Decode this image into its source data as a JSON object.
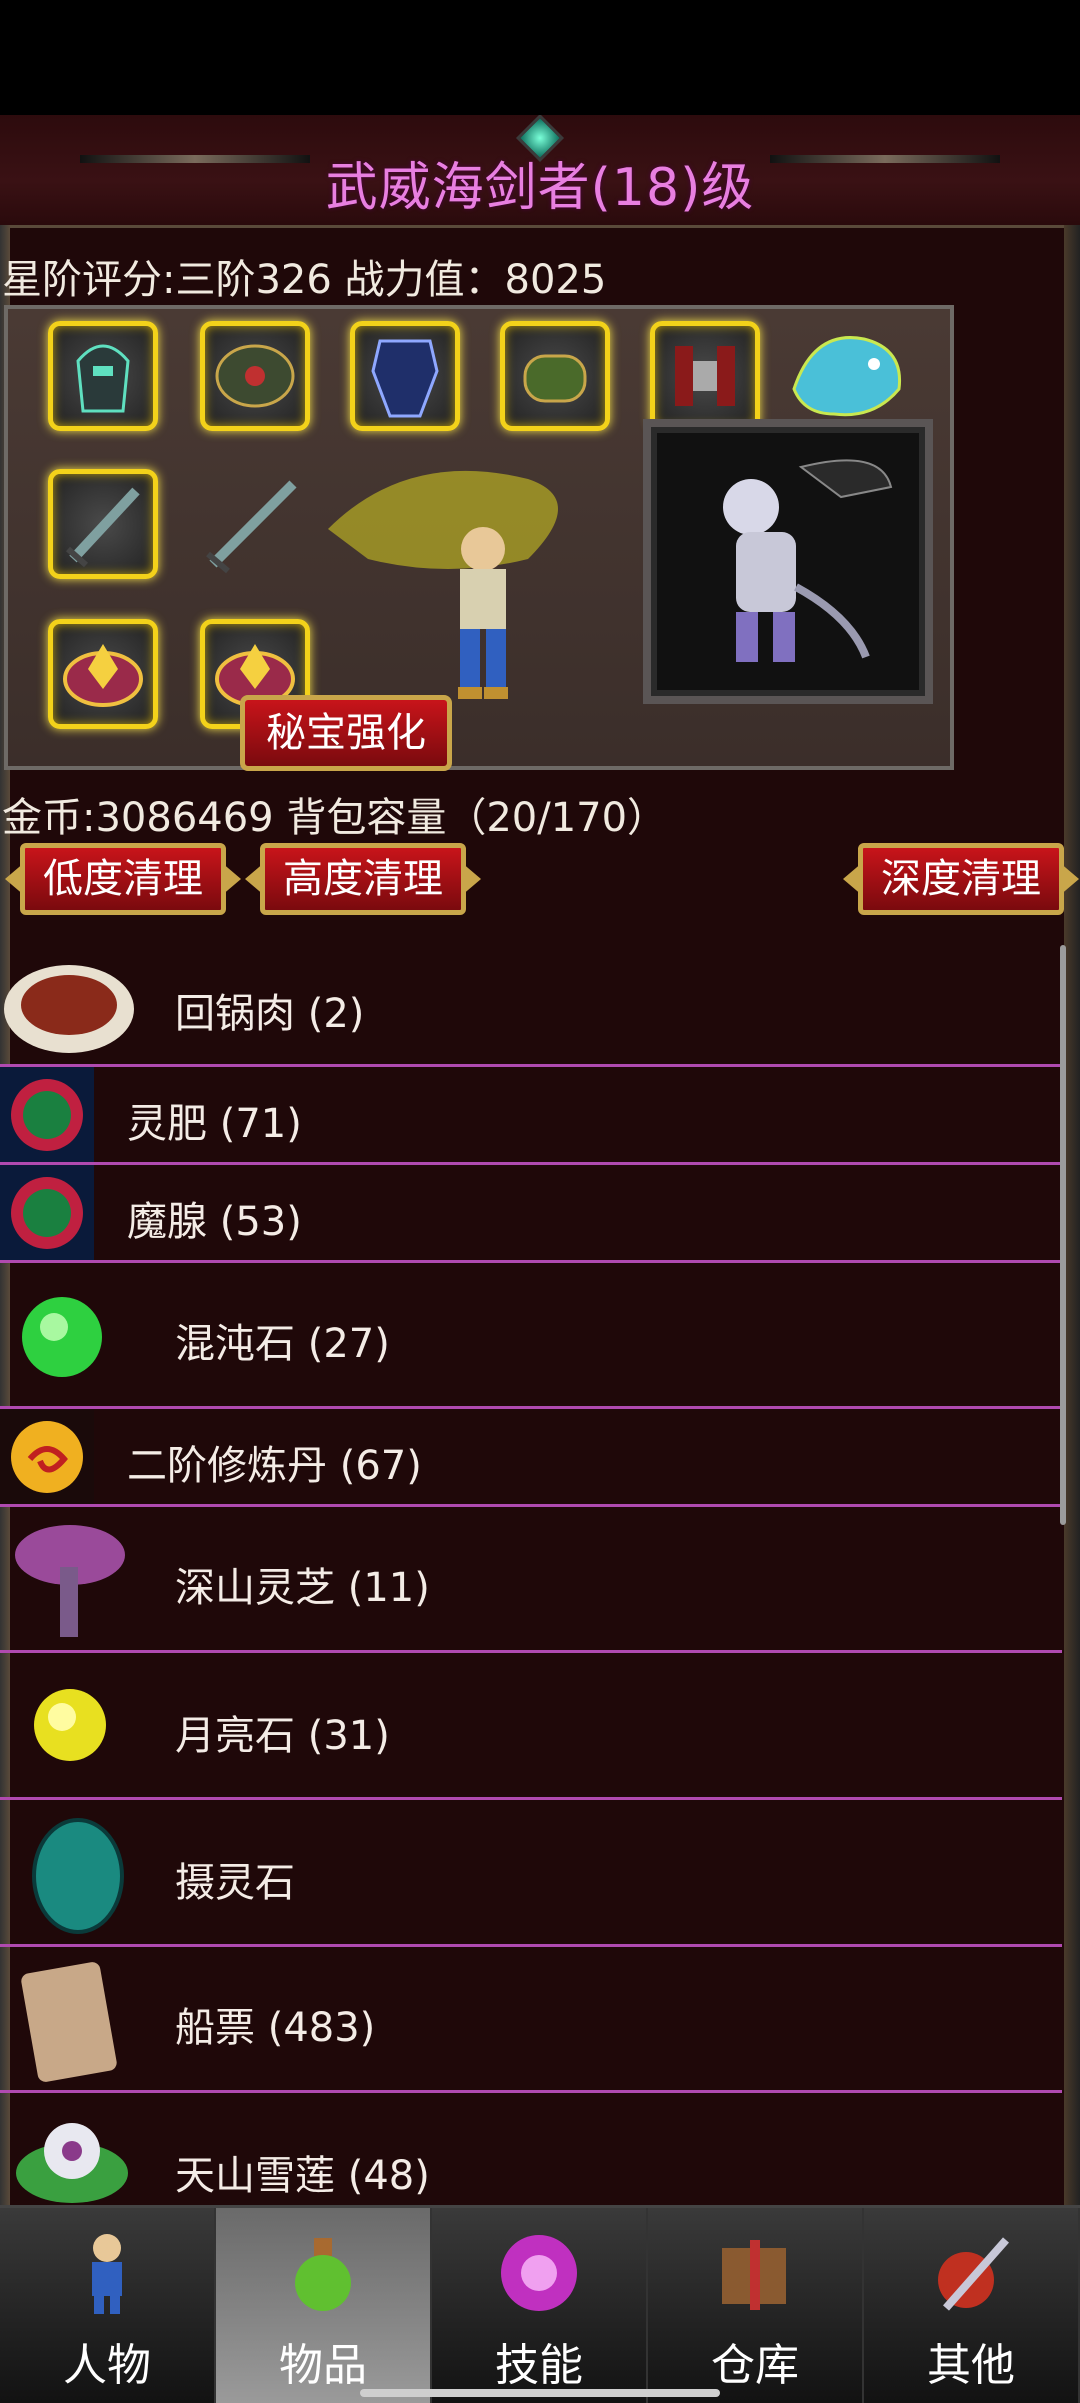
{
  "title": "武威海剑者(18)级",
  "rating": "星阶评分:三阶326 战力值：8025",
  "equipment": {
    "slots": [
      {
        "name": "helmet-icon"
      },
      {
        "name": "shoulder-armor-icon"
      },
      {
        "name": "chest-armor-icon"
      },
      {
        "name": "bracer-icon"
      },
      {
        "name": "belt-icon"
      },
      {
        "name": "mount-beast-icon"
      },
      {
        "name": "weapon-sword-icon"
      },
      {
        "name": "offhand-sword-icon"
      },
      {
        "name": "ring-left-icon"
      },
      {
        "name": "ring-right-icon"
      }
    ],
    "secret_button": "秘宝强化"
  },
  "gold": "金币:3086469 背包容量（20/170）",
  "clean_buttons": {
    "low": "低度清理",
    "high": "高度清理",
    "deep": "深度清理"
  },
  "items": [
    {
      "label": "回锅肉 (2)",
      "icon": "food-plate-icon"
    },
    {
      "label": "灵肥 (71)",
      "icon": "spirit-orb-icon"
    },
    {
      "label": "魔腺 (53)",
      "icon": "demon-gland-icon"
    },
    {
      "label": "混沌石 (27)",
      "icon": "green-stone-icon"
    },
    {
      "label": "二阶修炼丹 (67)",
      "icon": "pill-icon"
    },
    {
      "label": "深山灵芝 (11)",
      "icon": "mushroom-icon"
    },
    {
      "label": "月亮石 (31)",
      "icon": "moon-stone-icon"
    },
    {
      "label": "摄灵石",
      "icon": "teal-egg-icon"
    },
    {
      "label": "船票 (483)",
      "icon": "scroll-icon"
    },
    {
      "label": "天山雪莲 (48)",
      "icon": "lotus-icon"
    }
  ],
  "nav": {
    "tabs": [
      {
        "label": "人物",
        "icon": "character-icon"
      },
      {
        "label": "物品",
        "icon": "potion-icon"
      },
      {
        "label": "技能",
        "icon": "skill-orb-icon"
      },
      {
        "label": "仓库",
        "icon": "warehouse-icon"
      },
      {
        "label": "其他",
        "icon": "other-icon"
      }
    ],
    "active": "物品"
  }
}
